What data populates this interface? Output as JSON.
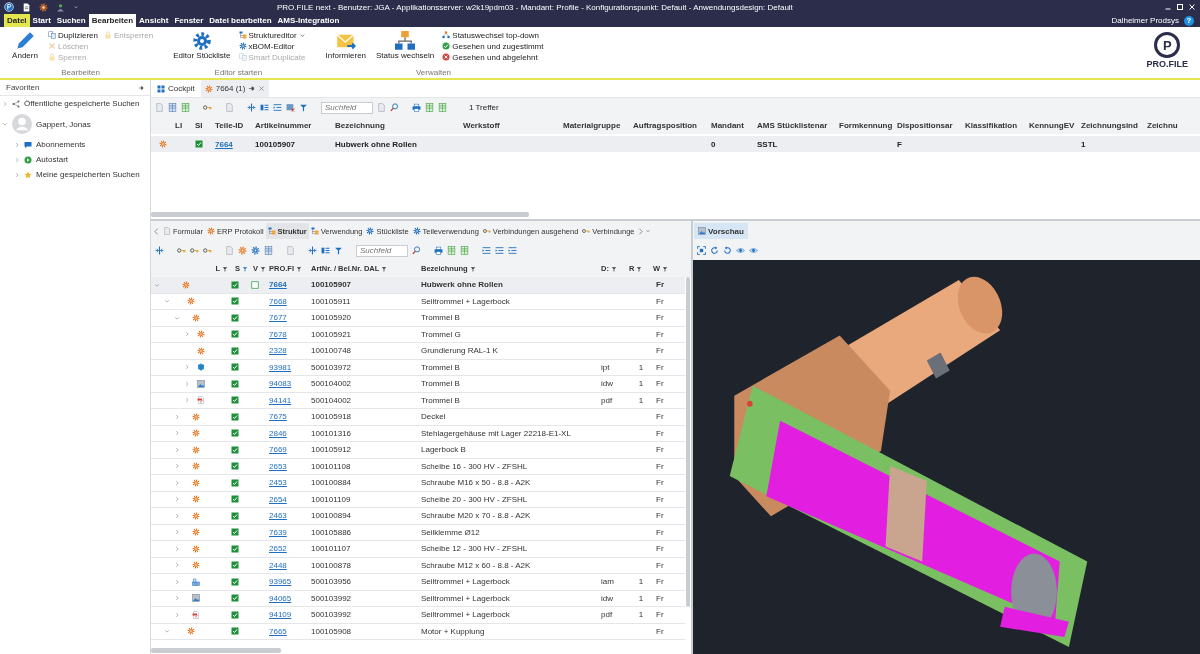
{
  "window": {
    "title": "PRO.FILE  next - Benutzer: JGA - Applikationsserver: w2k19pdm03 - Mandant: Profile - Konfigurationspunkt: Default - Anwendungsdesign: Default"
  },
  "menu": {
    "tabs": [
      {
        "label": "Datei",
        "kind": "file",
        "selected": false
      },
      {
        "label": "Start",
        "kind": "tab",
        "selected": false
      },
      {
        "label": "Suchen",
        "kind": "tab",
        "selected": false
      },
      {
        "label": "Bearbeiten",
        "kind": "tab",
        "selected": true
      },
      {
        "label": "Ansicht",
        "kind": "tab",
        "selected": false
      },
      {
        "label": "Fenster",
        "kind": "tab",
        "selected": false
      },
      {
        "label": "Datei bearbeiten",
        "kind": "tab",
        "selected": false
      },
      {
        "label": "AMS-Integration",
        "kind": "tab",
        "selected": false
      }
    ],
    "user": "Dalheimer Prodsys",
    "help": "?"
  },
  "ribbon": {
    "groups": [
      {
        "label": "Bearbeiten",
        "columns": [
          [
            {
              "label": "Ändern",
              "kind": "large",
              "disabled": false
            }
          ],
          [
            {
              "label": "Duplizieren",
              "kind": "small",
              "disabled": false
            },
            {
              "label": "Löschen",
              "kind": "small",
              "disabled": true
            },
            {
              "label": "Sperren",
              "kind": "small",
              "disabled": true
            }
          ],
          [
            {
              "label": "Entsperren",
              "kind": "small",
              "disabled": true
            }
          ]
        ]
      },
      {
        "label": "Editor starten",
        "columns": [
          [
            {
              "label": "Editor Stückliste",
              "kind": "large",
              "disabled": false
            }
          ],
          [
            {
              "label": "Struktureditor",
              "kind": "small",
              "disabled": false,
              "dropdown": true
            },
            {
              "label": "xBOM-Editor",
              "kind": "small",
              "disabled": false
            },
            {
              "label": "Smart Duplicate",
              "kind": "small",
              "disabled": true
            }
          ]
        ]
      },
      {
        "label": "Verwalten",
        "columns": [
          [
            {
              "label": "Informieren",
              "kind": "large",
              "disabled": false
            }
          ],
          [
            {
              "label": "Status wechseln",
              "kind": "large",
              "disabled": false
            }
          ],
          [
            {
              "label": "Statuswechsel top-down",
              "kind": "small",
              "disabled": false
            },
            {
              "label": "Gesehen und zugestimmt",
              "kind": "small",
              "disabled": false
            },
            {
              "label": "Gesehen und abgelehnt",
              "kind": "small",
              "disabled": false
            }
          ]
        ]
      }
    ]
  },
  "logo": {
    "mark": "P",
    "text": "PRO.FILE"
  },
  "sidebar": {
    "title": "Favoriten",
    "items": [
      {
        "label": "Öffentliche gespeicherte Suchen",
        "expanded": false
      },
      {
        "label": "Gappert, Jonas",
        "expanded": true,
        "children": [
          {
            "label": "Abonnements",
            "expanded": false
          },
          {
            "label": "Autostart",
            "expanded": false
          },
          {
            "label": "Meine gespeicherten Suchen",
            "expanded": false
          }
        ]
      }
    ]
  },
  "doc_tabs": [
    {
      "label": "Cockpit",
      "selected": false
    },
    {
      "label": "7664 (1)",
      "selected": true
    }
  ],
  "search": {
    "placeholder": "Suchfeld",
    "hits": "1 Treffer"
  },
  "table": {
    "columns": [
      "LI",
      "SI",
      "Teile-ID",
      "Artikelnummer",
      "Bezeichnung",
      "Werkstoff",
      "Materialgruppe",
      "Auftragsposition",
      "Mandant",
      "AMS Stücklistenar",
      "Formkennung",
      "Dispositionsar",
      "Klassifikation",
      "KennungEV",
      "Zeichnungsind",
      "Zeichnu"
    ],
    "rows": [
      {
        "kind": "article",
        "checked": true,
        "selected": true,
        "cells": [
          null,
          null,
          "7664",
          "100105907",
          "Hubwerk ohne Rollen",
          null,
          null,
          null,
          "0",
          "SSTL",
          null,
          "F",
          null,
          null,
          "1",
          null
        ]
      }
    ]
  },
  "detail_tabs": [
    {
      "label": "Formular",
      "selected": false
    },
    {
      "label": "ERP Protokoll",
      "selected": false
    },
    {
      "label": "Struktur",
      "selected": true
    },
    {
      "label": "Verwendung",
      "selected": false
    },
    {
      "label": "Stückliste",
      "selected": false
    },
    {
      "label": "Teileverwendung",
      "selected": false
    },
    {
      "label": "Verbindungen ausgehend",
      "selected": false
    },
    {
      "label": "Verbindunge",
      "selected": false
    }
  ],
  "structure": {
    "search_placeholder": "Suchfeld",
    "columns": [
      {
        "label": "L",
        "filtered": false
      },
      {
        "label": "S",
        "filtered": true
      },
      {
        "label": "V",
        "filtered": false
      },
      {
        "label": "PRO.FI",
        "filtered": false
      },
      {
        "label": "ArtNr. / Bel.Nr. DAL",
        "filtered": false
      },
      {
        "label": "Bezeichnung",
        "filtered": false
      },
      {
        "label": "D:",
        "filtered": false
      },
      {
        "label": "R",
        "filtered": false
      },
      {
        "label": "W",
        "filtered": false
      }
    ],
    "rows": [
      {
        "kind": "article",
        "selected": true,
        "expanded": true,
        "checked": true,
        "v_checked": false,
        "id": "7664",
        "article_no": "100105907",
        "name": "Hubwerk ohne Rollen",
        "w": "Fr",
        "children": [
          {
            "kind": "article",
            "selected": false,
            "expanded": true,
            "checked": true,
            "id": "7668",
            "article_no": "100105911",
            "name": "Seiltrommel + Lagerbock",
            "w": "Fr",
            "children": [
              {
                "kind": "article",
                "selected": false,
                "expanded": true,
                "checked": true,
                "id": "7677",
                "article_no": "100105920",
                "name": "Trommel B",
                "w": "Fr",
                "children": [
                  {
                    "kind": "article",
                    "selected": false,
                    "expanded": false,
                    "checked": true,
                    "id": "7678",
                    "article_no": "100105921",
                    "name": "Trommel G",
                    "w": "Fr"
                  },
                  {
                    "kind": "article",
                    "selected": false,
                    "checked": true,
                    "id": "2328",
                    "article_no": "100100748",
                    "name": "Grundierung RAL-1 K",
                    "w": "Fr"
                  },
                  {
                    "kind": "part",
                    "selected": false,
                    "expanded": false,
                    "checked": true,
                    "id": "93981",
                    "article_no": "500103972",
                    "name": "Trommel B",
                    "d": "ipt",
                    "r": "1",
                    "w": "Fr"
                  },
                  {
                    "kind": "drawing",
                    "selected": false,
                    "expanded": false,
                    "checked": true,
                    "id": "94083",
                    "article_no": "500104002",
                    "name": "Trommel B",
                    "d": "idw",
                    "r": "1",
                    "w": "Fr"
                  },
                  {
                    "kind": "pdf",
                    "selected": false,
                    "expanded": false,
                    "checked": true,
                    "id": "94141",
                    "article_no": "500104002",
                    "name": "Trommel B",
                    "d": "pdf",
                    "r": "1",
                    "w": "Fr"
                  }
                ]
              },
              {
                "kind": "article",
                "selected": false,
                "expanded": false,
                "checked": true,
                "id": "7675",
                "article_no": "100105918",
                "name": "Deckel",
                "w": "Fr"
              },
              {
                "kind": "article",
                "selected": false,
                "expanded": false,
                "checked": true,
                "id": "2846",
                "article_no": "100101316",
                "name": "Stehlagergehäuse mit Lager 22218-E1-XL",
                "w": "Fr"
              },
              {
                "kind": "article",
                "selected": false,
                "expanded": false,
                "checked": true,
                "id": "7669",
                "article_no": "100105912",
                "name": "Lagerbock B",
                "w": "Fr"
              },
              {
                "kind": "article",
                "selected": false,
                "expanded": false,
                "checked": true,
                "id": "2653",
                "article_no": "100101108",
                "name": "Scheibe 16 - 300 HV - ZFSHL",
                "w": "Fr"
              },
              {
                "kind": "article",
                "selected": false,
                "expanded": false,
                "checked": true,
                "id": "2453",
                "article_no": "100100884",
                "name": "Schraube M16 x 50 - 8.8 - A2K",
                "w": "Fr"
              },
              {
                "kind": "article",
                "selected": false,
                "expanded": false,
                "checked": true,
                "id": "2654",
                "article_no": "100101109",
                "name": "Scheibe 20 - 300 HV - ZFSHL",
                "w": "Fr"
              },
              {
                "kind": "article",
                "selected": false,
                "expanded": false,
                "checked": true,
                "id": "2463",
                "article_no": "100100894",
                "name": "Schraube M20 x 70 - 8.8 - A2K",
                "w": "Fr"
              },
              {
                "kind": "article",
                "selected": false,
                "expanded": false,
                "checked": true,
                "id": "7639",
                "article_no": "100105886",
                "name": "Seilklemme Ø12",
                "w": "Fr"
              },
              {
                "kind": "article",
                "selected": false,
                "expanded": false,
                "checked": true,
                "id": "2652",
                "article_no": "100101107",
                "name": "Scheibe 12 -  300 HV - ZFSHL",
                "w": "Fr"
              },
              {
                "kind": "article",
                "selected": false,
                "expanded": false,
                "checked": true,
                "id": "2448",
                "article_no": "100100878",
                "name": "Schraube M12 x 60 - 8.8 - A2K",
                "w": "Fr"
              },
              {
                "kind": "assembly",
                "selected": false,
                "expanded": false,
                "checked": true,
                "id": "93965",
                "article_no": "500103956",
                "name": "Seiltrommel + Lagerbock",
                "d": "iam",
                "r": "1",
                "w": "Fr"
              },
              {
                "kind": "drawing",
                "selected": false,
                "expanded": false,
                "checked": true,
                "id": "94065",
                "article_no": "500103992",
                "name": "Seiltrommel + Lagerbock",
                "d": "idw",
                "r": "1",
                "w": "Fr"
              },
              {
                "kind": "pdf",
                "selected": false,
                "expanded": false,
                "checked": true,
                "id": "94109",
                "article_no": "500103992",
                "name": "Seiltrommel + Lagerbock",
                "d": "pdf",
                "r": "1",
                "w": "Fr"
              }
            ]
          },
          {
            "kind": "article",
            "selected": false,
            "expanded": true,
            "checked": true,
            "id": "7665",
            "article_no": "100105908",
            "name": "Motor + Kupplung",
            "w": "Fr"
          }
        ]
      }
    ]
  },
  "preview": {
    "tabs": [
      {
        "label": "Vorschau",
        "selected": true
      }
    ]
  }
}
